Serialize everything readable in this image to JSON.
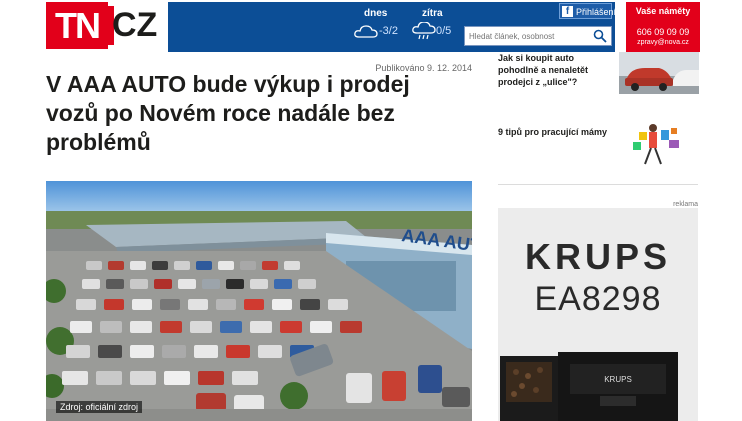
{
  "logo": {
    "tn": "TN",
    "cz": "CZ"
  },
  "weather": {
    "today_label": "dnes",
    "today_temp": "-3/2",
    "tomorrow_label": "zítra",
    "tomorrow_temp": "0/5"
  },
  "login": {
    "label": "Přihlášení"
  },
  "search": {
    "placeholder": "Hledat článek, osobnost"
  },
  "hotline": {
    "title": "Vaše náměty",
    "phone": "606 09 09 09",
    "email": "zpravy@nova.cz"
  },
  "article": {
    "published": "Publikováno 9. 12. 2014",
    "headline": "V AAA AUTO bude výkup i prodej vozů po Novém roce nadále bez problémů",
    "photo_caption": "Zdroj: oficiální zdroj",
    "sign_text": "AAA AUTO"
  },
  "sidebar": {
    "items": [
      {
        "title": "Jak si koupit auto pohodlně a nenaletět prodejci z „ulice\"?"
      },
      {
        "title": "9 tipů pro pracující mámy"
      }
    ],
    "ad_label": "reklama",
    "ad": {
      "brand": "KRUPS",
      "model": "EA8298",
      "machine_label": "KRUPS"
    }
  }
}
